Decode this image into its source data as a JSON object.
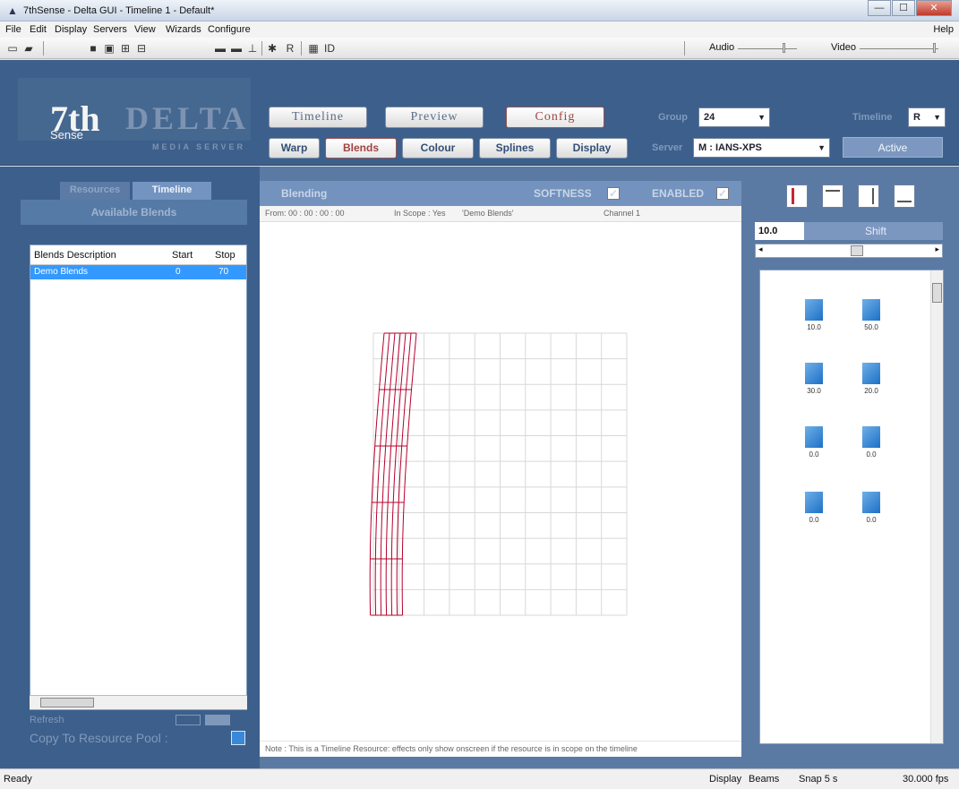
{
  "window": {
    "title": "7thSense - Delta GUI - Timeline 1 - Default*",
    "minimize": "—",
    "maximize": "☐",
    "close": "✕"
  },
  "menu": {
    "items": [
      "File",
      "Edit",
      "Display",
      "Servers",
      "View",
      "Wizards",
      "Configure"
    ],
    "help": "Help"
  },
  "toolbar": {
    "audio_label": "Audio",
    "video_label": "Video"
  },
  "logo": {
    "seven": "7th",
    "sense": "Sense",
    "delta": "DELTA",
    "sub": "MEDIA SERVER"
  },
  "header": {
    "mode_tabs": [
      "Timeline",
      "Preview",
      "Config"
    ],
    "sub_tabs": [
      "Warp",
      "Blends",
      "Colour",
      "Splines",
      "Display"
    ],
    "group_label": "Group",
    "group_value": "24",
    "server_label": "Server",
    "server_value": "M : IANS-XPS",
    "timeline_label": "Timeline",
    "timeline_value": "R",
    "active_label": "Active"
  },
  "left": {
    "tabs": [
      "Resources",
      "Timeline"
    ],
    "heading": "Available Blends",
    "columns": [
      "Blends Description",
      "Start",
      "Stop"
    ],
    "rows": [
      {
        "desc": "Demo Blends",
        "start": "0",
        "stop": "70"
      }
    ],
    "refresh_label": "Refresh",
    "copy_label": "Copy To Resource Pool :"
  },
  "center": {
    "header": "Blending",
    "softness_label": "SOFTNESS",
    "enabled_label": "ENABLED",
    "info": {
      "from": "From: 00 : 00 : 00 : 00",
      "scope": "In Scope : Yes",
      "name": "'Demo Blends'",
      "channel": "Channel 1"
    },
    "note": "Note : This is a Timeline Resource: effects only show onscreen if the resource is in scope on the timeline"
  },
  "right": {
    "value": "10.0",
    "shift_label": "Shift",
    "thumbs": [
      "10.0",
      "50.0",
      "30.0",
      "20.0",
      "0.0",
      "0.0",
      "0.0",
      "0.0"
    ]
  },
  "status": {
    "ready": "Ready",
    "display": "Display",
    "beams": "Beams",
    "snap": "Snap 5 s",
    "fps": "30.000 fps"
  }
}
